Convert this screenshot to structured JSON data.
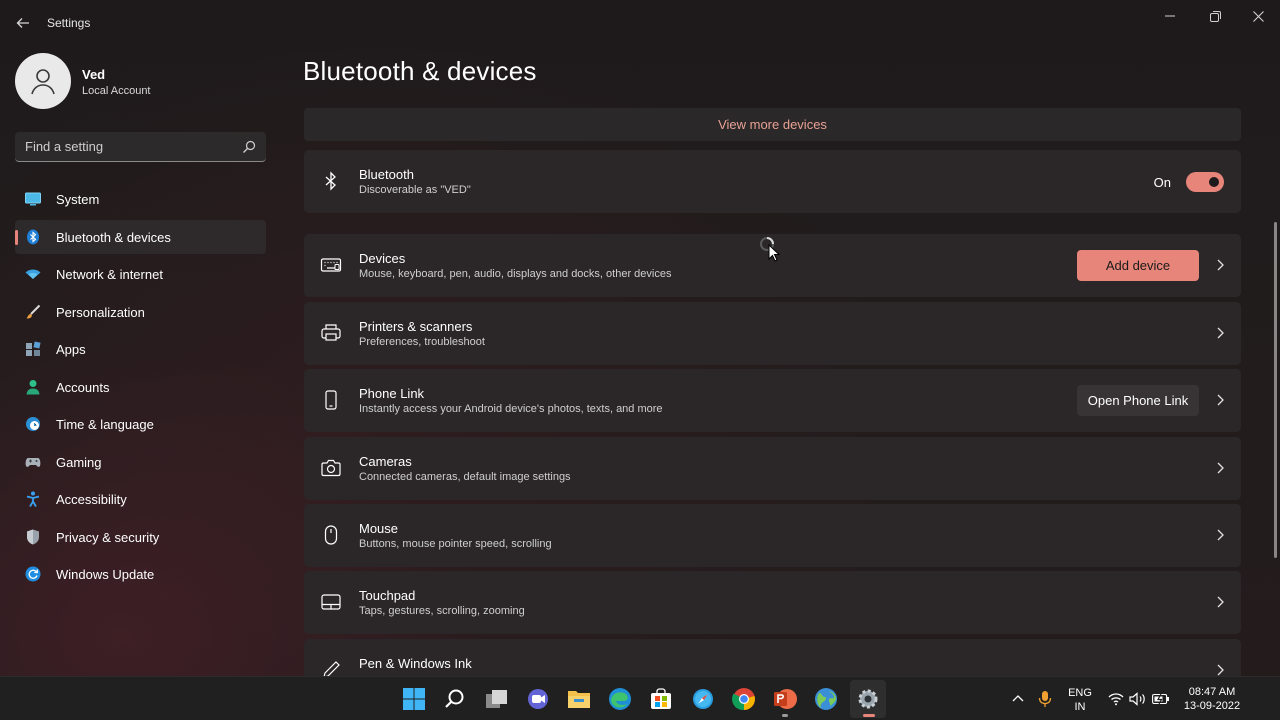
{
  "window": {
    "title": "Settings",
    "controls": [
      "minimize",
      "maximize",
      "close"
    ]
  },
  "profile": {
    "name": "Ved",
    "account_type": "Local Account"
  },
  "search": {
    "placeholder": "Find a setting"
  },
  "sidebar": {
    "items": [
      {
        "label": "System",
        "icon": "system-icon",
        "active": false
      },
      {
        "label": "Bluetooth & devices",
        "icon": "bluetooth-icon",
        "active": true
      },
      {
        "label": "Network & internet",
        "icon": "wifi-icon",
        "active": false
      },
      {
        "label": "Personalization",
        "icon": "brush-icon",
        "active": false
      },
      {
        "label": "Apps",
        "icon": "apps-icon",
        "active": false
      },
      {
        "label": "Accounts",
        "icon": "person-icon",
        "active": false
      },
      {
        "label": "Time & language",
        "icon": "clock-globe-icon",
        "active": false
      },
      {
        "label": "Gaming",
        "icon": "gamepad-icon",
        "active": false
      },
      {
        "label": "Accessibility",
        "icon": "accessibility-icon",
        "active": false
      },
      {
        "label": "Privacy & security",
        "icon": "shield-icon",
        "active": false
      },
      {
        "label": "Windows Update",
        "icon": "update-icon",
        "active": false
      }
    ]
  },
  "main": {
    "title": "Bluetooth & devices",
    "view_more": "View more devices",
    "bluetooth": {
      "title": "Bluetooth",
      "subtitle": "Discoverable as \"VED\"",
      "toggle_label": "On",
      "toggle_on": true
    },
    "cards": [
      {
        "title": "Devices",
        "subtitle": "Mouse, keyboard, pen, audio, displays and docks, other devices",
        "button": "Add device",
        "icon": "keyboard-devices-icon"
      },
      {
        "title": "Printers & scanners",
        "subtitle": "Preferences, troubleshoot",
        "icon": "printer-icon"
      },
      {
        "title": "Phone Link",
        "subtitle": "Instantly access your Android device's photos, texts, and more",
        "button": "Open Phone Link",
        "icon": "phone-icon"
      },
      {
        "title": "Cameras",
        "subtitle": "Connected cameras, default image settings",
        "icon": "camera-icon"
      },
      {
        "title": "Mouse",
        "subtitle": "Buttons, mouse pointer speed, scrolling",
        "icon": "mouse-icon"
      },
      {
        "title": "Touchpad",
        "subtitle": "Taps, gestures, scrolling, zooming",
        "icon": "touchpad-icon"
      },
      {
        "title": "Pen & Windows Ink",
        "subtitle": "",
        "icon": "pen-icon"
      }
    ]
  },
  "taskbar": {
    "apps": [
      "start",
      "search",
      "task-view",
      "teams-chat",
      "file-explorer",
      "edge",
      "store",
      "safari",
      "chrome",
      "powerpoint",
      "maps",
      "settings"
    ],
    "tray": {
      "lang_line1": "ENG",
      "lang_line2": "IN",
      "time": "08:47 AM",
      "date": "13-09-2022"
    }
  },
  "colors": {
    "accent": "#e8857a",
    "card_bg": "#2b2728",
    "taskbar_bg": "#202020"
  }
}
